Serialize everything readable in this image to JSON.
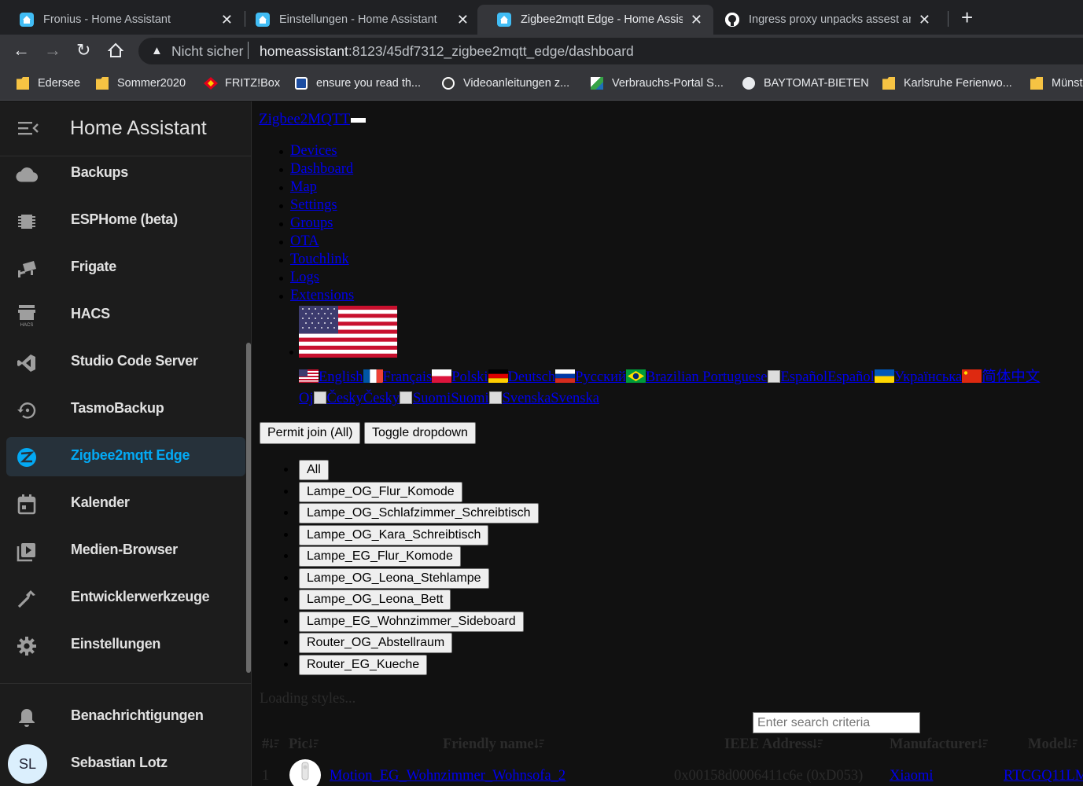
{
  "browser": {
    "tabs": [
      {
        "title": "Fronius - Home Assistant",
        "active": false,
        "icon": "home-assistant-icon"
      },
      {
        "title": "Einstellungen - Home Assistant",
        "active": false,
        "icon": "home-assistant-icon"
      },
      {
        "title": "Zigbee2mqtt Edge - Home Assist",
        "active": true,
        "icon": "home-assistant-icon"
      },
      {
        "title": "Ingress proxy unpacks assest and",
        "active": false,
        "icon": "github-icon"
      }
    ],
    "new_tab": "+",
    "security_label": "Nicht sicher",
    "url_host": "homeassistant",
    "url_rest": ":8123/45df7312_zigbee2mqtt_edge/dashboard",
    "bookmarks": [
      {
        "label": "Edersee",
        "icon": "folder-icon"
      },
      {
        "label": "Sommer2020",
        "icon": "folder-icon"
      },
      {
        "label": "FRITZ!Box",
        "icon": "fritzbox-icon"
      },
      {
        "label": "ensure you read th...",
        "icon": "site-icon"
      },
      {
        "label": "Videoanleitungen z...",
        "icon": "site-icon"
      },
      {
        "label": "Verbrauchs-Portal S...",
        "icon": "site-icon"
      },
      {
        "label": "BAYTOMAT-BIETEN",
        "icon": "globe-icon"
      },
      {
        "label": "Karlsruhe Ferienwo...",
        "icon": "folder-icon"
      },
      {
        "label": "Münst",
        "icon": "folder-icon"
      }
    ]
  },
  "sidebar": {
    "title": "Home Assistant",
    "items": [
      {
        "label": "Backups",
        "icon": "cloud-icon"
      },
      {
        "label": "ESPHome (beta)",
        "icon": "chip-icon"
      },
      {
        "label": "Frigate",
        "icon": "cctv-icon"
      },
      {
        "label": "HACS",
        "icon": "hacs-icon"
      },
      {
        "label": "Studio Code Server",
        "icon": "vscode-icon"
      },
      {
        "label": "TasmoBackup",
        "icon": "backup-restore-icon"
      },
      {
        "label": "Zigbee2mqtt Edge",
        "icon": "zigbee-icon",
        "active": true
      },
      {
        "label": "Kalender",
        "icon": "calendar-icon"
      },
      {
        "label": "Medien-Browser",
        "icon": "media-icon"
      },
      {
        "label": "Entwicklerwerkzeuge",
        "icon": "hammer-icon"
      },
      {
        "label": "Einstellungen",
        "icon": "cog-icon"
      }
    ],
    "notifications": "Benachrichtigungen",
    "user_initials": "SL",
    "user_name": "Sebastian Lotz"
  },
  "main": {
    "brand": "Zigbee2MQTT",
    "nav": [
      "Devices",
      "Dashboard",
      "Map",
      "Settings",
      "Groups",
      "OTA",
      "Touchlink",
      "Logs",
      "Extensions"
    ],
    "languages_row1": [
      "English",
      "Français",
      "Polski",
      "Deutsch",
      "Русский",
      "Brazilian Portuguese",
      "EspañolEspañol",
      "Українська",
      "简体中文"
    ],
    "languages_row2": [
      "Oj",
      "ČeskyČesky",
      "SuomiSuomi",
      "SvenskaSvenska"
    ],
    "permit_join": "Permit join (All)",
    "toggle_dropdown": "Toggle dropdown",
    "devices": [
      "All",
      "Lampe_OG_Flur_Komode",
      "Lampe_OG_Schlafzimmer_Schreibtisch",
      "Lampe_OG_Kara_Schreibtisch",
      "Lampe_EG_Flur_Komode",
      "Lampe_OG_Leona_Stehlampe",
      "Lampe_OG_Leona_Bett",
      "Lampe_EG_Wohnzimmer_Sideboard",
      "Router_OG_Abstellraum",
      "Router_EG_Kueche"
    ],
    "loading": "Loading styles...",
    "search_placeholder": "Enter search criteria",
    "columns": {
      "num": "#",
      "pic": "Pic",
      "friendly_name": "Friendly name",
      "ieee": "IEEE Address",
      "manufacturer": "Manufacturer",
      "model": "Model"
    },
    "row": {
      "num": "1",
      "friendly_name": "Motion_EG_Wohnzimmer_Wohnsofa_2",
      "ieee": "0x00158d0006411c6e (0xD053)",
      "manufacturer": "Xiaomi",
      "model": "RTCGQ11LM"
    }
  },
  "colors": {
    "accent": "#03a9f4",
    "link": "#0000ee",
    "sidebar_bg": "#1c1c1c"
  }
}
